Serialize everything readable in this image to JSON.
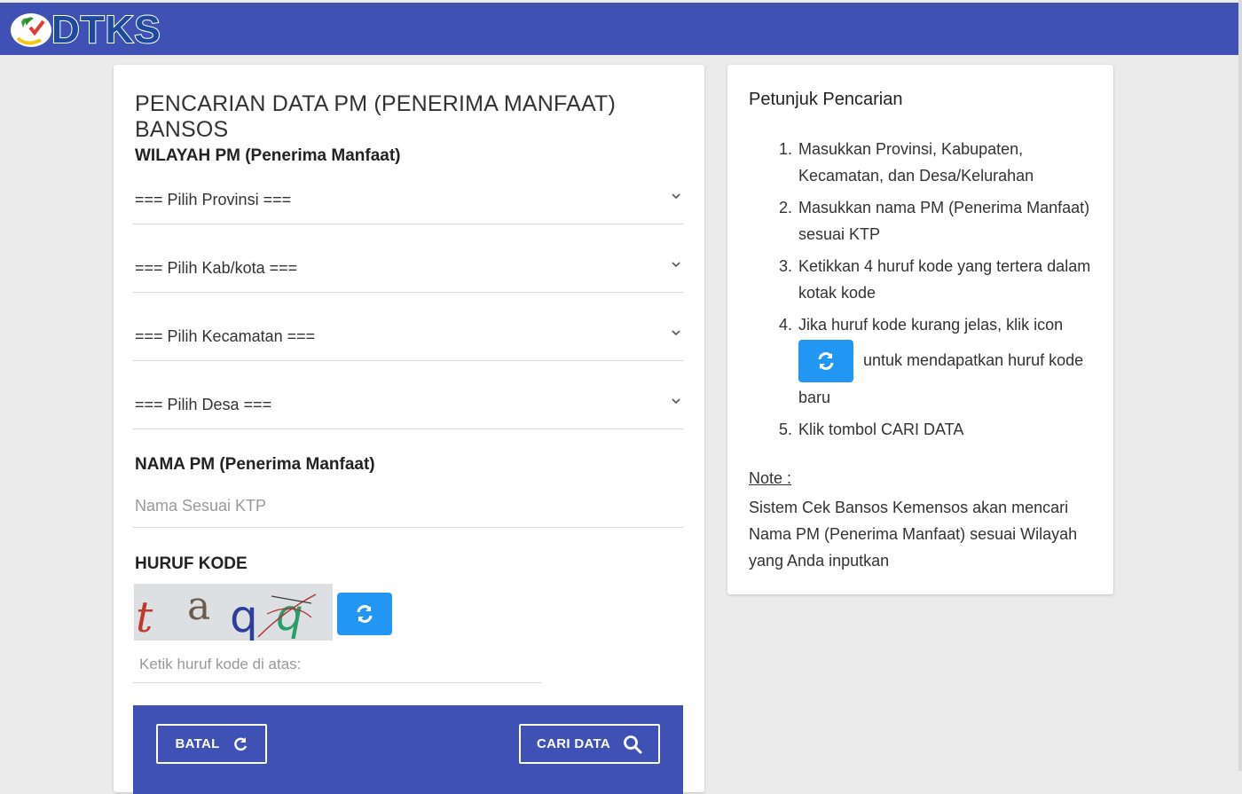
{
  "header": {
    "brand": "DTKS"
  },
  "form": {
    "title": "PENCARIAN DATA PM (PENERIMA MANFAAT) BANSOS",
    "wilayah_label": "WILAYAH PM (Penerima Manfaat)",
    "selects": [
      "=== Pilih Provinsi ===",
      "=== Pilih Kab/kota ===",
      "=== Pilih Kecamatan ===",
      "=== Pilih Desa ==="
    ],
    "name_label": "NAMA PM (Penerima Manfaat)",
    "name_placeholder": "Nama Sesuai KTP",
    "code_label": "HURUF KODE",
    "captcha_text": "t aqq",
    "code_placeholder": "Ketik huruf kode di atas:",
    "cancel_label": "BATAL",
    "search_label": "CARI DATA"
  },
  "help": {
    "title": "Petunjuk Pencarian",
    "steps": [
      {
        "num": "1.",
        "text": "Masukkan Provinsi, Kabupaten, Kecamatan, dan Desa/Kelurahan"
      },
      {
        "num": "2.",
        "text": "Masukkan nama PM (Penerima Manfaat) sesuai KTP"
      },
      {
        "num": "3.",
        "text": "Ketikkan 4 huruf kode yang tertera dalam kotak kode"
      },
      {
        "num": "4.",
        "text_before": "Jika huruf kode kurang jelas, klik icon",
        "text_after": "untuk mendapatkan huruf kode baru"
      },
      {
        "num": "5.",
        "text": "Klik tombol CARI DATA"
      }
    ],
    "note_label": "Note :",
    "note_text": "Sistem Cek Bansos Kemensos akan mencari Nama PM (Penerima Manfaat) sesuai Wilayah yang Anda inputkan"
  },
  "colors": {
    "primary": "#3f51b5",
    "refresh_button": "#2196f3",
    "background": "#ebebeb"
  },
  "icons": {
    "refresh": "refresh-icon",
    "search": "search-icon",
    "chevron": "chevron-down-icon",
    "reload": "reload-icon"
  }
}
